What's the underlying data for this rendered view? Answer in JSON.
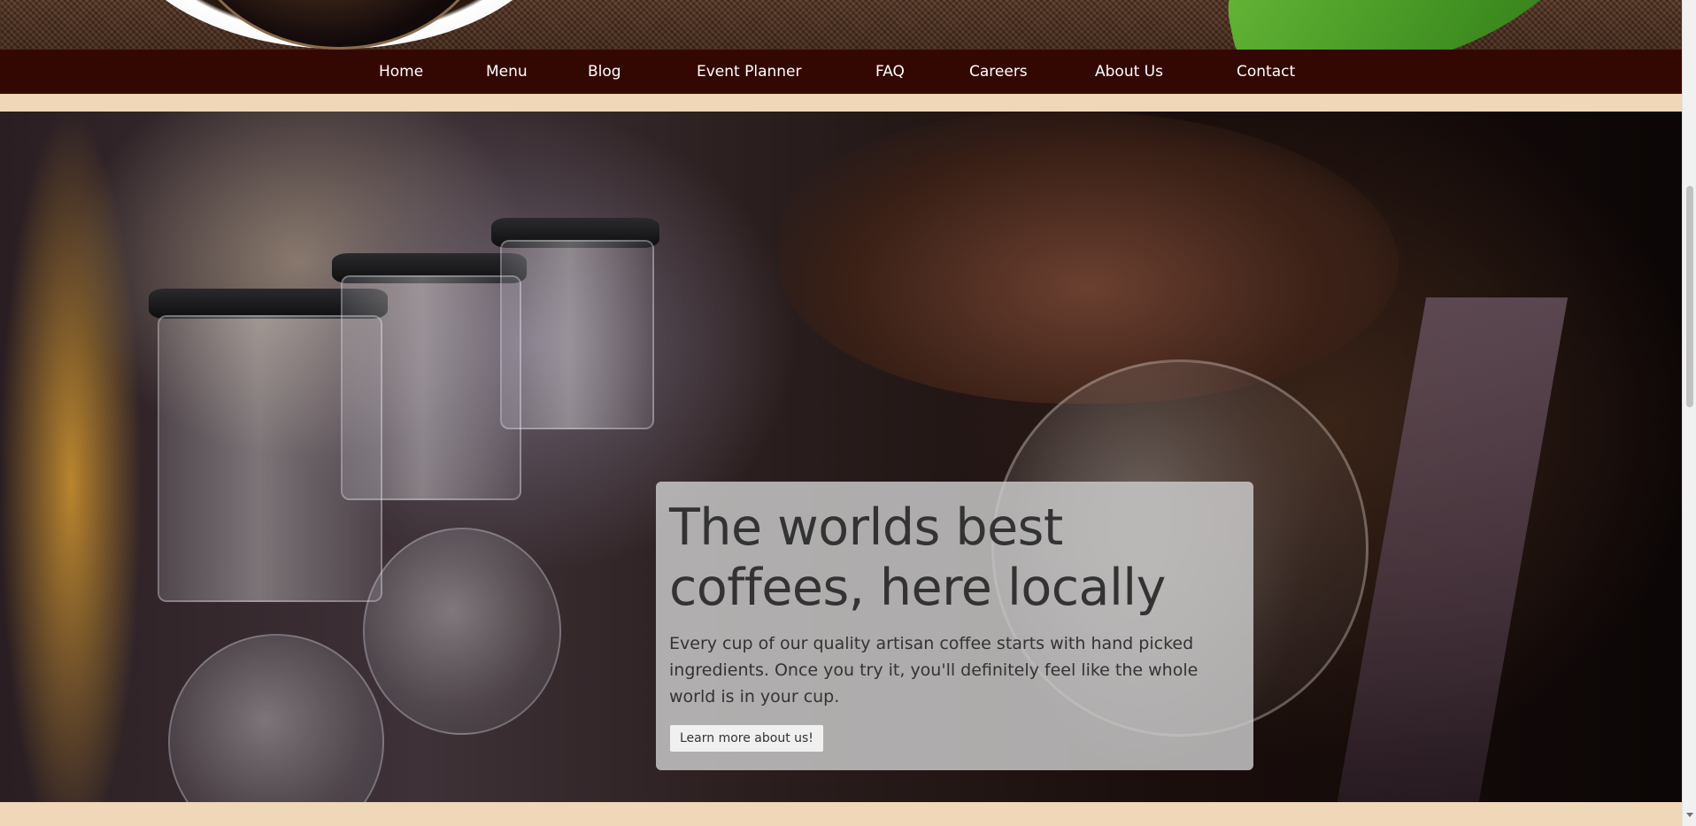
{
  "nav": {
    "items": [
      {
        "label": "Home"
      },
      {
        "label": "Menu"
      },
      {
        "label": "Blog"
      },
      {
        "label": "Event Planner"
      },
      {
        "label": "FAQ"
      },
      {
        "label": "Careers"
      },
      {
        "label": "About Us"
      },
      {
        "label": "Contact"
      }
    ]
  },
  "hero": {
    "title": "The worlds best coffees, here locally",
    "text": "Every cup of our quality artisan coffee starts with hand picked ingredients. Once you try it, you'll definitely feel like the whole world is in your cup.",
    "button_label": "Learn more about us!"
  },
  "colors": {
    "nav_background": "#340802",
    "page_background": "#efd7b7",
    "card_background": "#cdcdcd",
    "text_dark": "#333333"
  }
}
